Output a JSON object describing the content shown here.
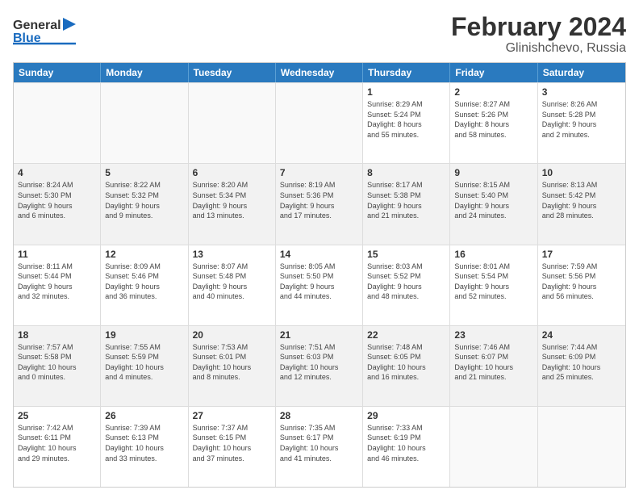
{
  "header": {
    "logo_line1": "General",
    "logo_line2": "Blue",
    "main_title": "February 2024",
    "subtitle": "Glinishchevo, Russia"
  },
  "calendar": {
    "days_of_week": [
      "Sunday",
      "Monday",
      "Tuesday",
      "Wednesday",
      "Thursday",
      "Friday",
      "Saturday"
    ],
    "weeks": [
      [
        {
          "day": "",
          "info": "",
          "empty": true
        },
        {
          "day": "",
          "info": "",
          "empty": true
        },
        {
          "day": "",
          "info": "",
          "empty": true
        },
        {
          "day": "",
          "info": "",
          "empty": true
        },
        {
          "day": "1",
          "info": "Sunrise: 8:29 AM\nSunset: 5:24 PM\nDaylight: 8 hours\nand 55 minutes."
        },
        {
          "day": "2",
          "info": "Sunrise: 8:27 AM\nSunset: 5:26 PM\nDaylight: 8 hours\nand 58 minutes."
        },
        {
          "day": "3",
          "info": "Sunrise: 8:26 AM\nSunset: 5:28 PM\nDaylight: 9 hours\nand 2 minutes."
        }
      ],
      [
        {
          "day": "4",
          "info": "Sunrise: 8:24 AM\nSunset: 5:30 PM\nDaylight: 9 hours\nand 6 minutes."
        },
        {
          "day": "5",
          "info": "Sunrise: 8:22 AM\nSunset: 5:32 PM\nDaylight: 9 hours\nand 9 minutes."
        },
        {
          "day": "6",
          "info": "Sunrise: 8:20 AM\nSunset: 5:34 PM\nDaylight: 9 hours\nand 13 minutes."
        },
        {
          "day": "7",
          "info": "Sunrise: 8:19 AM\nSunset: 5:36 PM\nDaylight: 9 hours\nand 17 minutes."
        },
        {
          "day": "8",
          "info": "Sunrise: 8:17 AM\nSunset: 5:38 PM\nDaylight: 9 hours\nand 21 minutes."
        },
        {
          "day": "9",
          "info": "Sunrise: 8:15 AM\nSunset: 5:40 PM\nDaylight: 9 hours\nand 24 minutes."
        },
        {
          "day": "10",
          "info": "Sunrise: 8:13 AM\nSunset: 5:42 PM\nDaylight: 9 hours\nand 28 minutes."
        }
      ],
      [
        {
          "day": "11",
          "info": "Sunrise: 8:11 AM\nSunset: 5:44 PM\nDaylight: 9 hours\nand 32 minutes."
        },
        {
          "day": "12",
          "info": "Sunrise: 8:09 AM\nSunset: 5:46 PM\nDaylight: 9 hours\nand 36 minutes."
        },
        {
          "day": "13",
          "info": "Sunrise: 8:07 AM\nSunset: 5:48 PM\nDaylight: 9 hours\nand 40 minutes."
        },
        {
          "day": "14",
          "info": "Sunrise: 8:05 AM\nSunset: 5:50 PM\nDaylight: 9 hours\nand 44 minutes."
        },
        {
          "day": "15",
          "info": "Sunrise: 8:03 AM\nSunset: 5:52 PM\nDaylight: 9 hours\nand 48 minutes."
        },
        {
          "day": "16",
          "info": "Sunrise: 8:01 AM\nSunset: 5:54 PM\nDaylight: 9 hours\nand 52 minutes."
        },
        {
          "day": "17",
          "info": "Sunrise: 7:59 AM\nSunset: 5:56 PM\nDaylight: 9 hours\nand 56 minutes."
        }
      ],
      [
        {
          "day": "18",
          "info": "Sunrise: 7:57 AM\nSunset: 5:58 PM\nDaylight: 10 hours\nand 0 minutes."
        },
        {
          "day": "19",
          "info": "Sunrise: 7:55 AM\nSunset: 5:59 PM\nDaylight: 10 hours\nand 4 minutes."
        },
        {
          "day": "20",
          "info": "Sunrise: 7:53 AM\nSunset: 6:01 PM\nDaylight: 10 hours\nand 8 minutes."
        },
        {
          "day": "21",
          "info": "Sunrise: 7:51 AM\nSunset: 6:03 PM\nDaylight: 10 hours\nand 12 minutes."
        },
        {
          "day": "22",
          "info": "Sunrise: 7:48 AM\nSunset: 6:05 PM\nDaylight: 10 hours\nand 16 minutes."
        },
        {
          "day": "23",
          "info": "Sunrise: 7:46 AM\nSunset: 6:07 PM\nDaylight: 10 hours\nand 21 minutes."
        },
        {
          "day": "24",
          "info": "Sunrise: 7:44 AM\nSunset: 6:09 PM\nDaylight: 10 hours\nand 25 minutes."
        }
      ],
      [
        {
          "day": "25",
          "info": "Sunrise: 7:42 AM\nSunset: 6:11 PM\nDaylight: 10 hours\nand 29 minutes."
        },
        {
          "day": "26",
          "info": "Sunrise: 7:39 AM\nSunset: 6:13 PM\nDaylight: 10 hours\nand 33 minutes."
        },
        {
          "day": "27",
          "info": "Sunrise: 7:37 AM\nSunset: 6:15 PM\nDaylight: 10 hours\nand 37 minutes."
        },
        {
          "day": "28",
          "info": "Sunrise: 7:35 AM\nSunset: 6:17 PM\nDaylight: 10 hours\nand 41 minutes."
        },
        {
          "day": "29",
          "info": "Sunrise: 7:33 AM\nSunset: 6:19 PM\nDaylight: 10 hours\nand 46 minutes."
        },
        {
          "day": "",
          "info": "",
          "empty": true
        },
        {
          "day": "",
          "info": "",
          "empty": true
        }
      ]
    ]
  }
}
